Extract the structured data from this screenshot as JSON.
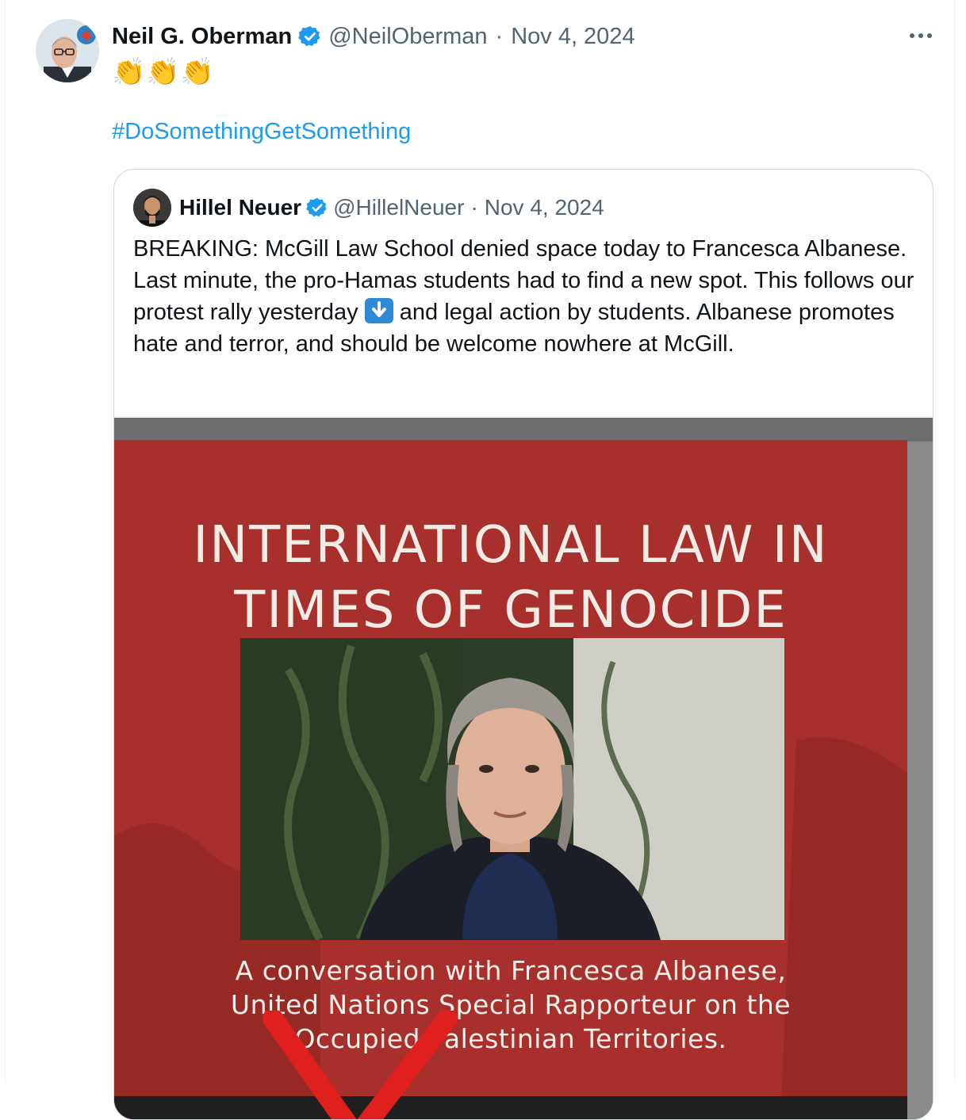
{
  "tweet": {
    "author_name": "Neil G. Oberman",
    "handle": "@NeilOberman",
    "separator": "·",
    "date": "Nov 4, 2024",
    "emoji": "👏👏👏",
    "hashtag": "#DoSomethingGetSomething",
    "more_icon": "more-horizontal-icon"
  },
  "quote": {
    "author_name": "Hillel Neuer",
    "handle": "@HillelNeuer",
    "separator": "·",
    "date": "Nov 4, 2024",
    "text_before_emoji": "BREAKING: McGill Law School denied space today to Francesca Albanese. Last minute, the pro-Hamas students had to find a new spot. This follows our protest rally yesterday ",
    "text_after_emoji": " and legal action by students. Albanese promotes hate and terror, and should be welcome nowhere at McGill.",
    "emoji_icon": "down-arrow-emoji",
    "media": {
      "title_line1": "INTERNATIONAL LAW IN",
      "title_line2": "TIMES OF GENOCIDE",
      "subtitle_line1": "A conversation with Francesca Albanese,",
      "subtitle_line2": "United Nations Special Rapporteur on the",
      "subtitle_line3": "Occupied Palestinian Territories.",
      "accent_color": "#a8302c",
      "overlay_mark_color": "#e0201c"
    }
  },
  "colors": {
    "link": "#1d9bf0",
    "secondary_text": "#536471",
    "verified": "#1d9bf0",
    "border": "#cfd9de"
  }
}
